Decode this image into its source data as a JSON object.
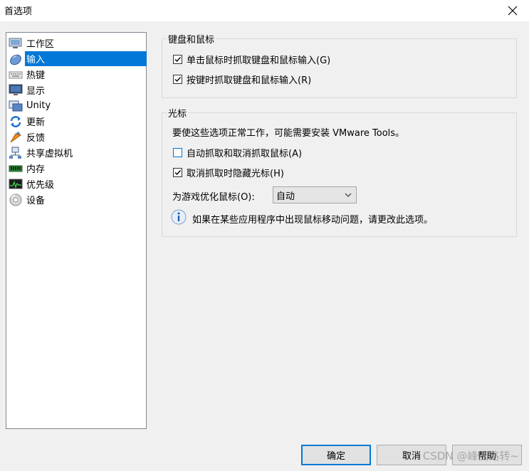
{
  "window": {
    "title": "首选项"
  },
  "sidebar": {
    "items": [
      {
        "label": "工作区",
        "icon": "workspace-icon",
        "selected": false
      },
      {
        "label": "输入",
        "icon": "mouse-icon",
        "selected": true
      },
      {
        "label": "热键",
        "icon": "keyboard-icon",
        "selected": false
      },
      {
        "label": "显示",
        "icon": "monitor-icon",
        "selected": false
      },
      {
        "label": "Unity",
        "icon": "unity-icon",
        "selected": false
      },
      {
        "label": "更新",
        "icon": "update-icon",
        "selected": false
      },
      {
        "label": "反馈",
        "icon": "feedback-icon",
        "selected": false
      },
      {
        "label": "共享虚拟机",
        "icon": "shared-vm-icon",
        "selected": false
      },
      {
        "label": "内存",
        "icon": "memory-icon",
        "selected": false
      },
      {
        "label": "优先级",
        "icon": "priority-icon",
        "selected": false
      },
      {
        "label": "设备",
        "icon": "device-icon",
        "selected": false
      }
    ]
  },
  "keyboard_mouse": {
    "title": "键盘和鼠标",
    "grab_on_click": {
      "label": "单击鼠标时抓取键盘和鼠标输入(G)",
      "checked": true
    },
    "grab_on_keypress": {
      "label": "按键时抓取键盘和鼠标输入(R)",
      "checked": true
    }
  },
  "cursor": {
    "title": "光标",
    "note": "要使这些选项正常工作，可能需要安装 VMware Tools。",
    "auto_grab": {
      "label": "自动抓取和取消抓取鼠标(A)",
      "checked": false
    },
    "hide_cursor": {
      "label": "取消抓取时隐藏光标(H)",
      "checked": true
    },
    "optimize_label": "为游戏优化鼠标(O):",
    "optimize_value": "自动",
    "info_text": "如果在某些应用程序中出现鼠标移动问题，请更改此选项。"
  },
  "footer": {
    "ok_label": "确定",
    "cancel_label": "取消",
    "help_label": "帮助",
    "watermark": "CSDN @峰回路转~"
  },
  "colors": {
    "selection": "#0078d7",
    "background": "#f0f0f0"
  }
}
